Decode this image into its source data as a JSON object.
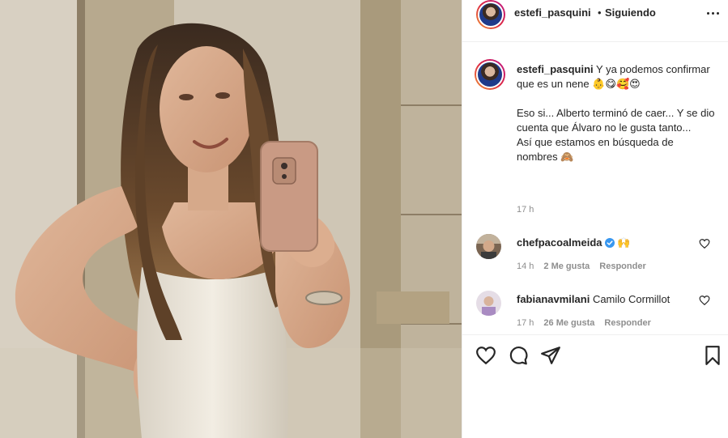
{
  "post": {
    "username": "estefi_pasquini",
    "separator": "•",
    "follow_status": "Siguiendo"
  },
  "caption": {
    "username": "estefi_pasquini",
    "text": "Y ya podemos confirmar que es un nene 👶😋🥰😍\n\nEso si... Alberto terminó de caer... Y se dio cuenta que Álvaro no le gusta tanto...\nAsí que estamos en búsqueda de nombres 🙈",
    "time": "17 h"
  },
  "comments": [
    {
      "username": "chefpacoalmeida",
      "verified": true,
      "text": "🙌",
      "time": "14 h",
      "likes": "2 Me gusta",
      "reply_label": "Responder"
    },
    {
      "username": "fabianavmilani",
      "verified": false,
      "text": "Camilo Cormillot",
      "time": "17 h",
      "likes": "26 Me gusta",
      "reply_label": "Responder"
    }
  ],
  "icons": {
    "more": "more-options-icon",
    "like": "heart-icon",
    "comment": "comment-icon",
    "share": "share-icon",
    "save": "bookmark-icon",
    "verified": "verified-badge-icon"
  },
  "colors": {
    "verified": "#3897f0",
    "muted_text": "#8e8e8e",
    "primary_text": "#262626"
  }
}
